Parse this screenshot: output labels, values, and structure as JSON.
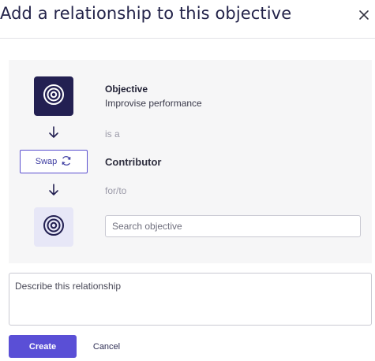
{
  "dialog": {
    "title": "Add a relationship to this objective"
  },
  "relationship": {
    "source_label": "Objective",
    "source_name": "Improvise performance",
    "verb": "is a",
    "type": "Contributor",
    "preposition": "for/to",
    "swap_label": "Swap"
  },
  "search": {
    "placeholder": "Search objective",
    "value": ""
  },
  "description": {
    "placeholder": "Describe this relationship",
    "value": ""
  },
  "actions": {
    "create_label": "Create",
    "cancel_label": "Cancel"
  },
  "colors": {
    "primary": "#5a4fd6",
    "badge_dark": "#232052",
    "badge_light": "#e7e7f7",
    "panel_bg": "#f6f6f7"
  },
  "icons": {
    "close": "close-icon",
    "target": "target-icon",
    "arrow": "arrow-down-icon",
    "swap": "swap-icon"
  }
}
